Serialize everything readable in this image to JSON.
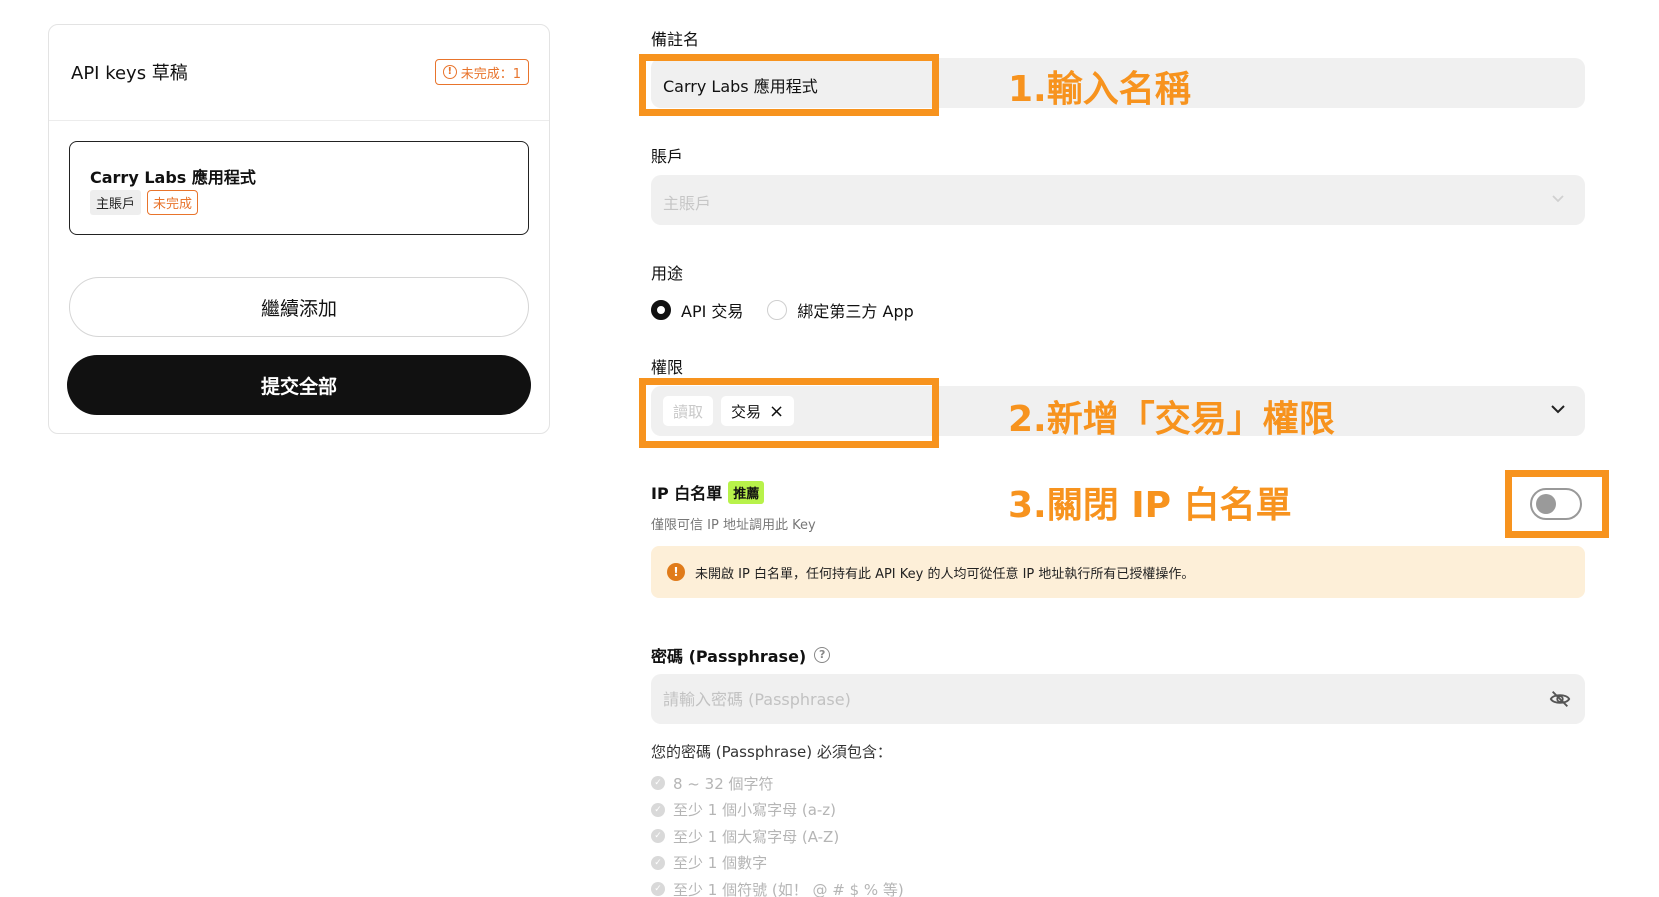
{
  "draft": {
    "title": "API keys 草稿",
    "incomplete_count_label": "未完成：1",
    "item": {
      "name": "Carry Labs 應用程式",
      "account_tag": "主賬戶",
      "status_tag": "未完成"
    },
    "continue_label": "繼續添加",
    "submit_label": "提交全部"
  },
  "form": {
    "name_label": "備註名",
    "name_value": "Carry Labs 應用程式",
    "account_label": "賬戶",
    "account_value": "主賬戶",
    "purpose_label": "用途",
    "purpose_options": [
      {
        "label": "API 交易",
        "selected": true
      },
      {
        "label": "綁定第三方 App",
        "selected": false
      }
    ],
    "permission_label": "權限",
    "permissions": [
      {
        "label": "讀取",
        "enabled": false
      },
      {
        "label": "交易",
        "enabled": true,
        "remove_icon": "×"
      }
    ],
    "ip_whitelist": {
      "title": "IP 白名單",
      "badge": "推薦",
      "subtitle": "僅限可信 IP 地址調用此 Key",
      "enabled": false,
      "warning": "未開啟 IP 白名單，任何持有此 API Key 的人均可從任意 IP 地址執行所有已授權操作。",
      "warning_icon": "!"
    },
    "passphrase": {
      "label": "密碼 (Passphrase)",
      "help_icon": "?",
      "placeholder": "請輸入密碼 (Passphrase)",
      "requirements_title": "您的密碼 (Passphrase) 必須包含：",
      "requirements": [
        "8 ~ 32 個字符",
        "至少 1 個小寫字母 (a-z)",
        "至少 1 個大寫字母 (A-Z)",
        "至少 1 個數字",
        "至少 1 個符號 (如！ @ # $ % 等)"
      ]
    }
  },
  "annotations": {
    "step1": "1.輸入名稱",
    "step2": "2.新增「交易」權限",
    "step3": "3.關閉 IP 白名單",
    "color": "#f7931e"
  },
  "icons": {
    "warning": "warning-circle-icon",
    "chevron": "chevron-down-icon",
    "eye": "eye-off-icon",
    "help": "question-circle-icon",
    "check": "check-circle-icon"
  }
}
